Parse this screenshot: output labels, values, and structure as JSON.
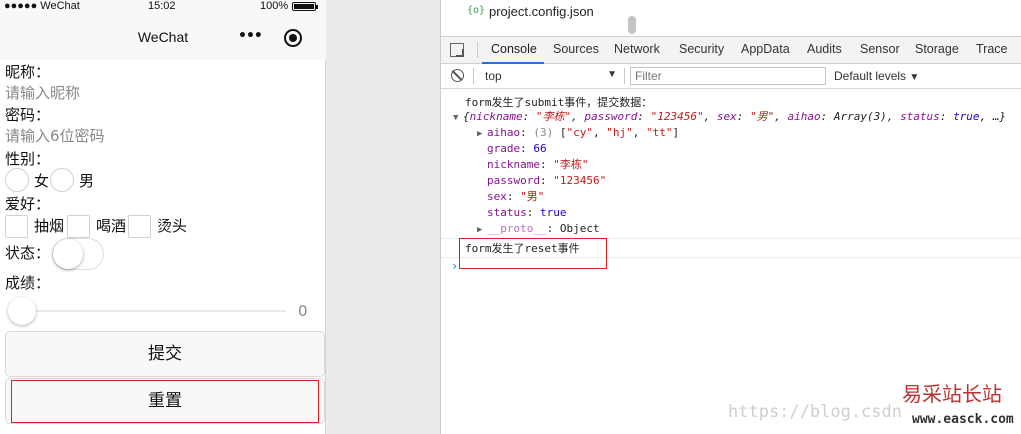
{
  "phone": {
    "status_bar": {
      "signal": "●●●●● WeChat",
      "time": "15:02",
      "battery": "100%",
      "battery_level": 1.0
    },
    "nav_title": "WeChat",
    "nav_icons": [
      "more-icon",
      "target-icon"
    ],
    "form": {
      "nickname_label": "昵称：",
      "nickname_placeholder": "请输入昵称",
      "password_label": "密码：",
      "password_placeholder": "请输入6位密码",
      "gender_label": "性别：",
      "gender_options": [
        "女",
        "男"
      ],
      "hobby_label": "爱好：",
      "hobby_options": [
        "抽烟",
        "喝酒",
        "烫头"
      ],
      "status_label": "状态：",
      "status_on": false,
      "grade_label": "成绩：",
      "grade_value": "0",
      "submit_label": "提交",
      "reset_label": "重置"
    }
  },
  "devtools": {
    "file_tab": {
      "icon": "{o}",
      "name": "project.config.json"
    },
    "tabs": [
      "Console",
      "Sources",
      "Network",
      "Security",
      "AppData",
      "Audits",
      "Sensor",
      "Storage",
      "Trace"
    ],
    "active_tab": "Console",
    "toolbar": {
      "context": "top",
      "filter_placeholder": "Filter",
      "levels": "Default levels"
    },
    "console": {
      "submit_msg": "form发生了submit事件，提交数据：",
      "summary": {
        "nickname": "\"李栋\"",
        "password": "\"123456\"",
        "sex": "\"男\"",
        "aihao": "Array(3)",
        "status": "true",
        "tail": "…}"
      },
      "props": {
        "aihao_count": "(3)",
        "aihao_items": [
          "\"cy\"",
          "\"hj\"",
          "\"tt\""
        ],
        "grade": "66",
        "nickname": "\"李栋\"",
        "password": "\"123456\"",
        "sex": "\"男\"",
        "status": "true",
        "proto": "Object"
      },
      "reset_msg": "form发生了reset事件",
      "prompt": "›"
    }
  },
  "watermark": {
    "url": "https://blog.csdn",
    "logo": "易采站长站",
    "site": "www.easck.com"
  },
  "colors": {
    "accent": "#1a73e8",
    "highlight_box": "#e02020",
    "key": "#881391",
    "string": "#c41a16",
    "number": "#1c00cf"
  }
}
